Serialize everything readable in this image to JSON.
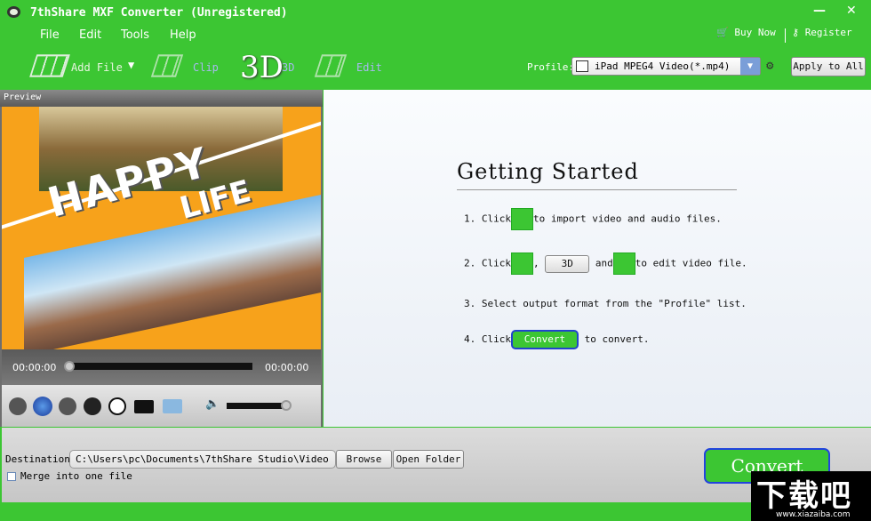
{
  "window": {
    "title": "7thShare MXF Converter (Unregistered)",
    "minimize": "—",
    "close": "✕"
  },
  "menu": [
    "File",
    "Edit",
    "Tools",
    "Help"
  ],
  "toolbar": {
    "add_file": "Add File",
    "clip": "Clip",
    "threed_logo": "3D",
    "threed": "3D",
    "edit": "Edit",
    "buy_now": "Buy Now",
    "register": "Register",
    "profile_label": "Profile:",
    "profile_value": "iPad MPEG4 Video(*.mp4)",
    "apply_all": "Apply to All"
  },
  "preview": {
    "label": "Preview",
    "title_art": "HAPPY LIFE",
    "time_current": "00:00:00",
    "time_total": "00:00:00",
    "progress": 0,
    "volume": 0.95
  },
  "getting_started": {
    "title": "Getting Started",
    "step1": {
      "num": "1. Click",
      "text": "to import video and audio files."
    },
    "step2": {
      "num": "2. Click",
      "comma": ",",
      "btn3d": "3D",
      "and": "and",
      "text": "to edit video file."
    },
    "step3": {
      "text": "3. Select output format from the \"Profile\" list."
    },
    "step4": {
      "num": "4. Click",
      "btn": "Convert",
      "text": "to convert."
    }
  },
  "bottom": {
    "destination_label": "Destination:",
    "destination_value": "C:\\Users\\pc\\Documents\\7thShare Studio\\Video",
    "browse": "Browse",
    "open_folder": "Open Folder",
    "merge_label": "Merge into one file",
    "merge_checked": false,
    "convert": "Convert"
  },
  "watermark": {
    "text": "下载吧",
    "url": "www.xiazaiba.com"
  }
}
